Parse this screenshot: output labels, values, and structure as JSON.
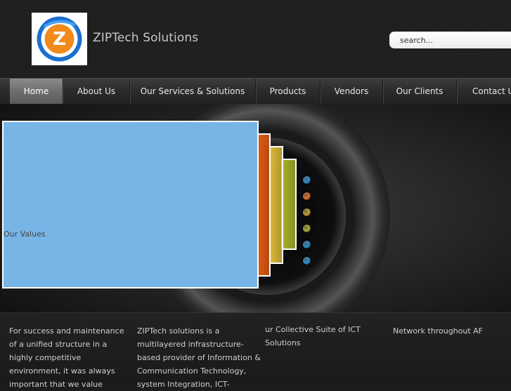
{
  "brand": {
    "name": "ZIPTech Solutions",
    "logo_letter": "Z"
  },
  "search": {
    "placeholder": "search..."
  },
  "nav": {
    "items": [
      {
        "label": "Home",
        "active": true
      },
      {
        "label": "About Us"
      },
      {
        "label": "Our Services & Solutions"
      },
      {
        "label": "Products"
      },
      {
        "label": "Vendors"
      },
      {
        "label": "Our Clients"
      },
      {
        "label": "Contact Us"
      }
    ]
  },
  "slider": {
    "caption": "Our Values",
    "tab_colors": [
      "#e05a12",
      "#d8b838",
      "#a8b02a"
    ],
    "dot_colors": [
      "#2a8fd0",
      "#e0702a",
      "#c8a030",
      "#a8b030",
      "#2a8fd0",
      "#2a8fd0"
    ]
  },
  "columns": [
    "For success and maintenance of a unified structure in a highly competitive environment, it was always important that we value",
    "ZIPTech solutions is a multilayered infrastructure-based provider of Information & Communication Technology, system Integration, ICT-",
    "ur Collective Suite of ICT Solutions",
    "Network throughout AF"
  ],
  "colors": {
    "slide_main": "#78b5e7",
    "nav_active": "#7a7a7a",
    "logo_blue": "#1a6fd0",
    "logo_orange": "#f08a1a"
  }
}
